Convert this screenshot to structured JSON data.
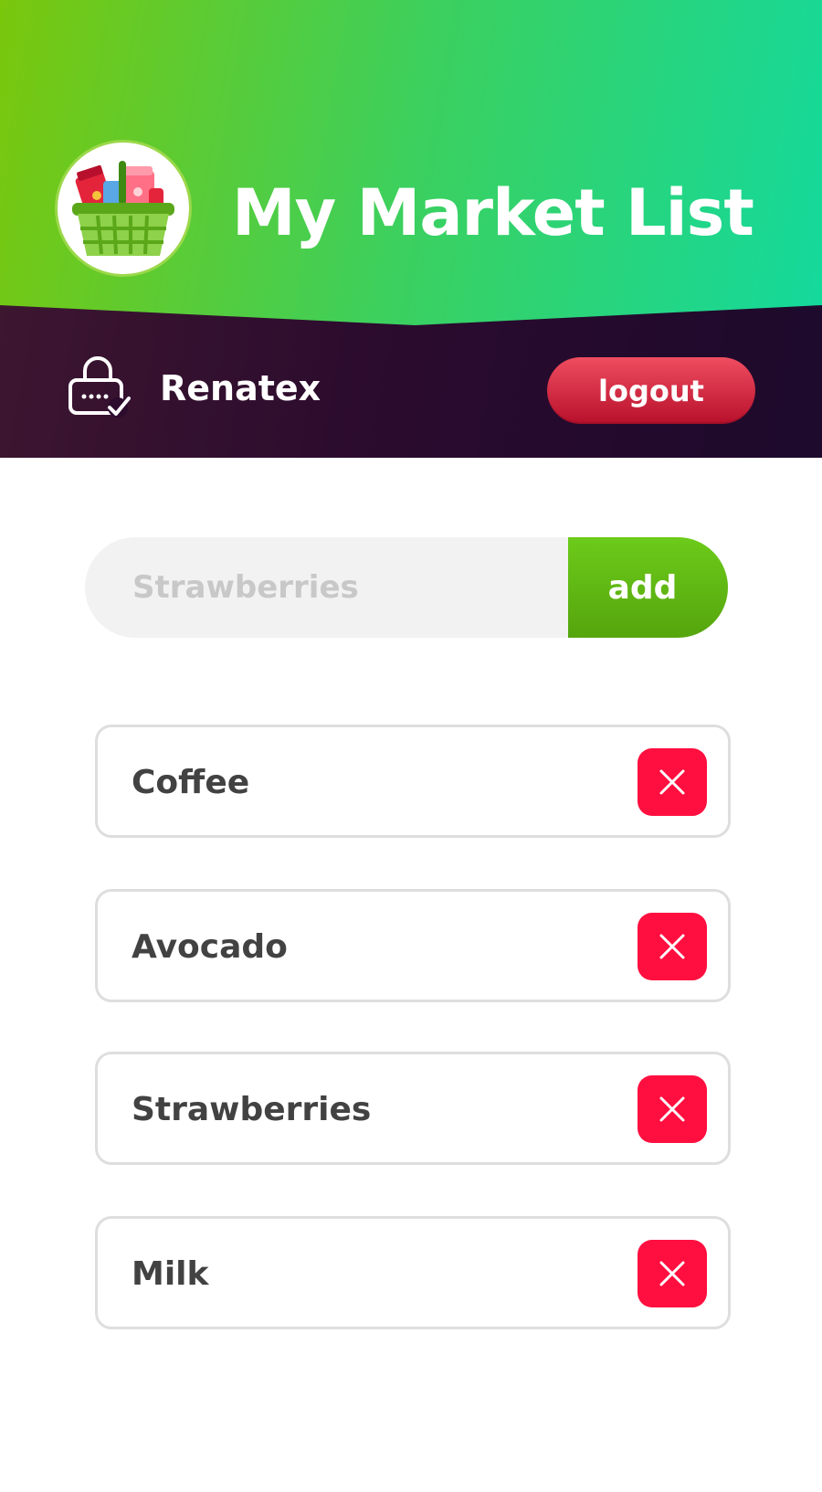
{
  "app": {
    "title": "My Market List"
  },
  "user": {
    "name": "Renatex",
    "logout_label": "logout"
  },
  "add_form": {
    "placeholder": "Strawberries",
    "add_label": "add"
  },
  "items": [
    {
      "label": "Coffee"
    },
    {
      "label": "Avocado"
    },
    {
      "label": "Strawberries"
    },
    {
      "label": "Milk"
    }
  ],
  "icons": {
    "logo": "shopping-basket-icon",
    "lock": "lock-check-icon",
    "remove": "close-icon"
  },
  "colors": {
    "header_gradient_start": "#7ac70c",
    "header_gradient_end": "#14d99c",
    "userbar": "#2b0b2e",
    "logout": "#d8203a",
    "add_button": "#5fb814",
    "remove_button": "#ff0f3f",
    "input_bg": "#f2f2f2"
  }
}
